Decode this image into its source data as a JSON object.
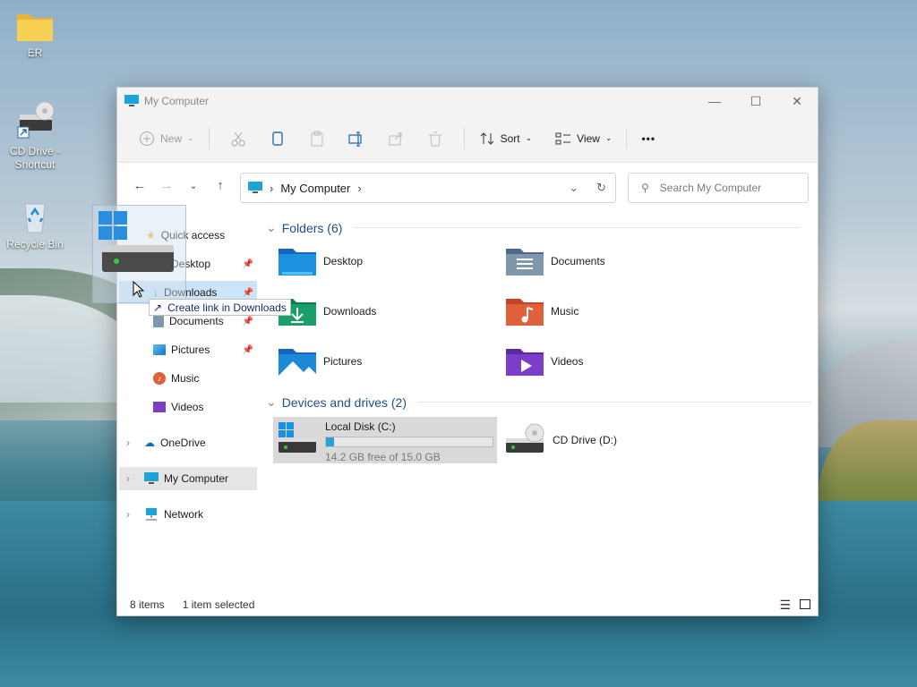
{
  "desktop": {
    "icons": [
      {
        "label": "ER",
        "icon": "folder-icon"
      },
      {
        "label": "CD Drive - Shortcut",
        "icon": "cd-drive-icon"
      },
      {
        "label": "Recycle Bin",
        "icon": "recycle-bin-icon"
      }
    ]
  },
  "window": {
    "title": "My Computer",
    "controls": {
      "minimize": "—",
      "maximize": "☐",
      "close": "✕"
    }
  },
  "toolbar": {
    "new_label": "New",
    "sort_label": "Sort",
    "view_label": "View",
    "more_label": "•••"
  },
  "navbar": {
    "address_crumb": "My Computer",
    "search_placeholder": "Search My Computer"
  },
  "sidebar": {
    "items": [
      {
        "label": "Quick access",
        "icon": "star-icon"
      },
      {
        "label": "Desktop",
        "icon": "desktop-folder-icon",
        "pinned": true
      },
      {
        "label": "Downloads",
        "icon": "download-icon",
        "pinned": true
      },
      {
        "label": "Documents",
        "icon": "documents-icon",
        "pinned": true
      },
      {
        "label": "Pictures",
        "icon": "pictures-icon",
        "pinned": true
      },
      {
        "label": "Music",
        "icon": "music-icon"
      },
      {
        "label": "Videos",
        "icon": "videos-icon"
      },
      {
        "label": "OneDrive",
        "icon": "cloud-icon"
      },
      {
        "label": "My Computer",
        "icon": "computer-icon"
      },
      {
        "label": "Network",
        "icon": "network-icon"
      }
    ]
  },
  "content": {
    "folders_header": "Folders (6)",
    "folders": [
      {
        "label": "Desktop",
        "color": "#1e90e0"
      },
      {
        "label": "Documents",
        "color": "#6e8fb0"
      },
      {
        "label": "Downloads",
        "color": "#1a9f6a"
      },
      {
        "label": "Music",
        "color": "#e0603a"
      },
      {
        "label": "Pictures",
        "color": "#1e88d8"
      },
      {
        "label": "Videos",
        "color": "#7a3ec8"
      }
    ],
    "devices_header": "Devices and drives (2)",
    "drives": [
      {
        "label": "Local Disk (C:)",
        "free": "14.2 GB free of 15.0 GB",
        "used_fraction": 0.05
      },
      {
        "label": "CD Drive (D:)"
      }
    ]
  },
  "status": {
    "items": "8 items",
    "selected": "1 item selected"
  },
  "drag": {
    "tooltip": "Create link in Downloads"
  },
  "colors": {
    "accent": "#26a0da",
    "selection": "#cce4f7",
    "header_text": "#1f4e8c"
  }
}
